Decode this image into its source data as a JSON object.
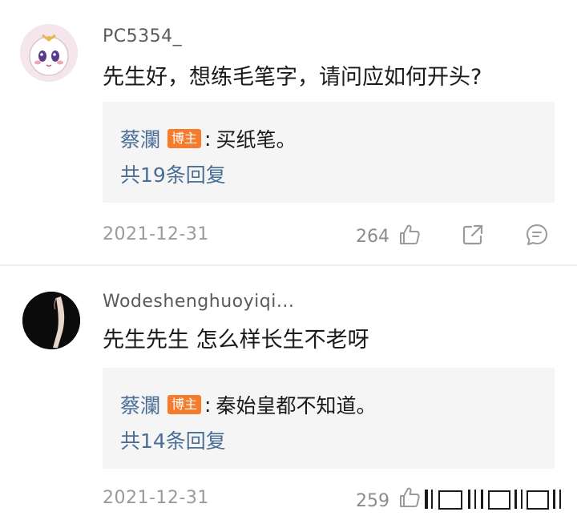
{
  "comments": [
    {
      "username": "PC5354_",
      "text": "先生好，想练毛笔字，请问应如何开头?",
      "reply": {
        "author": "蔡瀾",
        "badge": "博主",
        "colon": ":",
        "text": "买纸笔。",
        "count_label": "共19条回复"
      },
      "date": "2021-12-31",
      "likes": "264"
    },
    {
      "username": "Wodeshenghuoyiqi...",
      "text": "先生先生 怎么样长生不老呀",
      "reply": {
        "author": "蔡瀾",
        "badge": "博主",
        "colon": ":",
        "text": "秦始皇都不知道。",
        "count_label": "共14条回复"
      },
      "date": "2021-12-31",
      "likes": "259"
    }
  ],
  "icons": {
    "like": "thumbs-up-icon",
    "share": "share-icon",
    "reply": "comment-icon"
  },
  "colors": {
    "link_blue": "#4a6e96",
    "badge_orange": "#f47c2c",
    "meta_gray": "#9a9a9a",
    "reply_bg": "#f5f5f5"
  }
}
